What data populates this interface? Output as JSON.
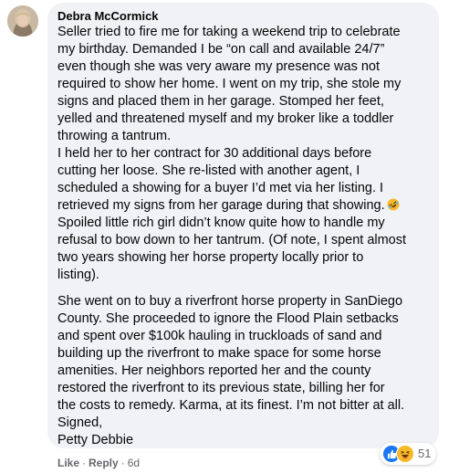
{
  "comment": {
    "author": "Debra McCormick",
    "paragraphs": [
      [
        "Seller tried to fire me for taking a weekend trip to celebrate",
        "my birthday. Demanded I be “on call and available 24/7”",
        "even though she was very aware my presence was not",
        "required to show her home. I went on my trip, she stole my",
        "signs and placed them in her garage. Stomped her feet,",
        "yelled and threatened myself and my broker like a toddler",
        "throwing a tantrum.",
        "I held her to her contract for 30 additional days before",
        "cutting her loose. She re-listed with another agent, I",
        "scheduled a showing for a buyer I’d met via her listing. I",
        "retrieved my signs from her garage during that showing.",
        "Spoiled little rich girl didn’t know quite how to handle my",
        "refusal to bow down to her tantrum. (Of note, I spent almost",
        "two years showing her horse property locally prior to",
        "listing)."
      ],
      [
        "She went on to buy a riverfront horse property in SanDiego",
        "County. She proceeded to ignore the Flood Plain setbacks",
        "and spent over $100k hauling in truckloads of sand and",
        "building up the riverfront to make space for some horse",
        "amenities. Her neighbors reported her and the county",
        "restored the riverfront to its previous state, billing her for",
        "the costs to remedy. Karma, at its finest. I’m not bitter at all.",
        "Signed,",
        "Petty Debbie"
      ]
    ],
    "inline_emoji": "rolling-on-floor-laughing",
    "reactions": {
      "types": [
        "like",
        "haha"
      ],
      "count": "51"
    },
    "actions": {
      "like": "Like",
      "separator": "·",
      "reply": "Reply",
      "time": "6d"
    }
  },
  "colors": {
    "bubble": "#f0f2f5",
    "text": "#050505",
    "meta": "#65676b",
    "like_blue": "#1877f2",
    "haha_yellow": "#f7b928"
  }
}
